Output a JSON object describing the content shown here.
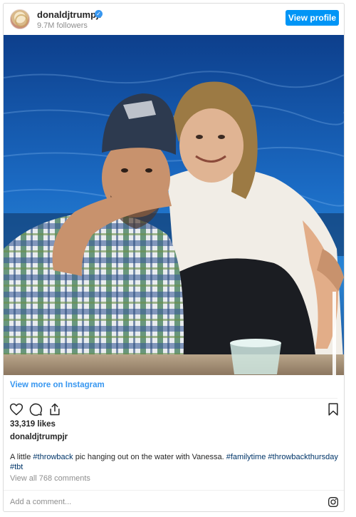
{
  "header": {
    "username": "donaldjtrumpjr",
    "followers": "9.7M followers",
    "view_profile_label": "View profile",
    "verified_icon": "verified-badge-icon"
  },
  "photo": {
    "alt": "A little #throwback pic hanging out on the water with Vanessa."
  },
  "view_more_label": "View more on Instagram",
  "actions": {
    "icons": [
      "heart-icon",
      "comment-icon",
      "share-icon",
      "bookmark-icon"
    ]
  },
  "likes": "33,319 likes",
  "post_author": "donaldjtrumpjr",
  "caption": {
    "text": "A little ",
    "tag1": "#throwback",
    "text2": " pic hanging out on the water with Vanessa. ",
    "tag2": "#familytime",
    "tag3": "#throwbackthursday",
    "tag4": "#tbt"
  },
  "view_all_comments": "View all 768 comments",
  "comment_box": {
    "placeholder": "Add a comment..."
  },
  "colors": {
    "accent": "#0095f6",
    "link": "#3897f0",
    "hashtag": "#003569",
    "muted": "#8e8e8e"
  }
}
